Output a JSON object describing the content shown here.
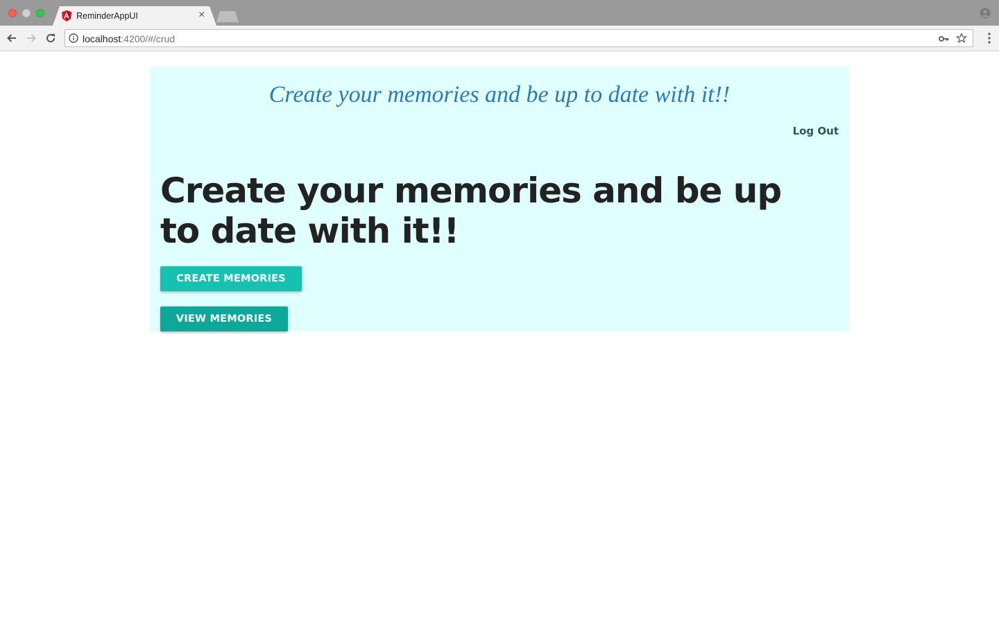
{
  "browser": {
    "tab_title": "ReminderAppUI",
    "tab_close": "×",
    "url_host": "localhost",
    "url_rest": ":4200/#/crud"
  },
  "page": {
    "tagline": "Create your memories and be up to date with it!!",
    "logout_label": "Log Out",
    "headline": "Create your memories and be up to date with it!!",
    "create_button": "CREATE MEMORIES",
    "view_button": "VIEW MEMORIES"
  },
  "colors": {
    "panel_background": "#e0ffff",
    "tagline": "#2a7ab8",
    "create_button": "#17c1b1",
    "view_button": "#0ea89a",
    "logout_text": "#2f5757"
  }
}
